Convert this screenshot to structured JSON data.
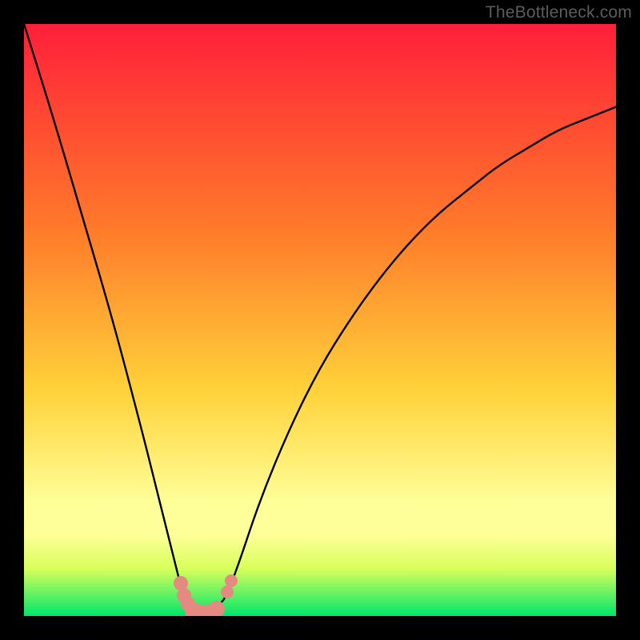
{
  "watermark": "TheBottleneck.com",
  "colors": {
    "frame_bg": "#000000",
    "grad_top": "#ff1f3a",
    "grad_mid1": "#ff7b2a",
    "grad_mid2": "#ffd23a",
    "grad_band_light": "#ffff9a",
    "grad_near_bottom": "#d8ff5a",
    "grad_bottom": "#00e66a",
    "curve_stroke": "#000000",
    "marker_fill": "#e58a80",
    "watermark_text": "#5c5c5c"
  },
  "chart_data": {
    "type": "line",
    "title": "",
    "xlabel": "",
    "ylabel": "",
    "xlim": [
      0,
      100
    ],
    "ylim": [
      0,
      100
    ],
    "notes": "Background is a vertical gradient from red (top, high bottleneck) through orange/yellow to green (bottom, balanced). Black curve shows bottleneck % vs component balance; minimum ≈0% around x≈28–32. A few salmon markers sit near the trough.",
    "series": [
      {
        "name": "bottleneck-curve",
        "x": [
          0,
          5,
          10,
          15,
          20,
          22,
          24,
          26,
          27,
          28,
          29,
          30,
          31,
          32,
          33,
          34,
          36,
          40,
          45,
          50,
          55,
          60,
          65,
          70,
          75,
          80,
          85,
          90,
          95,
          100
        ],
        "y": [
          100,
          84,
          67,
          50,
          31,
          23,
          15,
          7,
          3,
          1,
          0,
          0,
          0,
          1,
          2,
          3,
          8,
          20,
          32,
          42,
          50,
          57,
          63,
          68,
          72,
          76,
          79,
          82,
          84,
          86
        ]
      }
    ],
    "markers": [
      {
        "x": 26.5,
        "y": 5.5,
        "r": 9
      },
      {
        "x": 27.0,
        "y": 3.5,
        "r": 9
      },
      {
        "x": 27.7,
        "y": 2.0,
        "r": 9
      },
      {
        "x": 28.6,
        "y": 0.8,
        "r": 11
      },
      {
        "x": 30.0,
        "y": 0.3,
        "r": 12
      },
      {
        "x": 31.4,
        "y": 0.5,
        "r": 11
      },
      {
        "x": 32.5,
        "y": 1.2,
        "r": 10
      },
      {
        "x": 34.3,
        "y": 4.0,
        "r": 8
      },
      {
        "x": 35.0,
        "y": 6.0,
        "r": 8
      }
    ],
    "gradient_stops": [
      {
        "pct": 0,
        "key": "grad_top"
      },
      {
        "pct": 35,
        "key": "grad_mid1"
      },
      {
        "pct": 62,
        "key": "grad_mid2"
      },
      {
        "pct": 81,
        "key": "grad_band_light"
      },
      {
        "pct": 86,
        "key": "grad_band_light"
      },
      {
        "pct": 92,
        "key": "grad_near_bottom"
      },
      {
        "pct": 100,
        "key": "grad_bottom"
      }
    ]
  }
}
